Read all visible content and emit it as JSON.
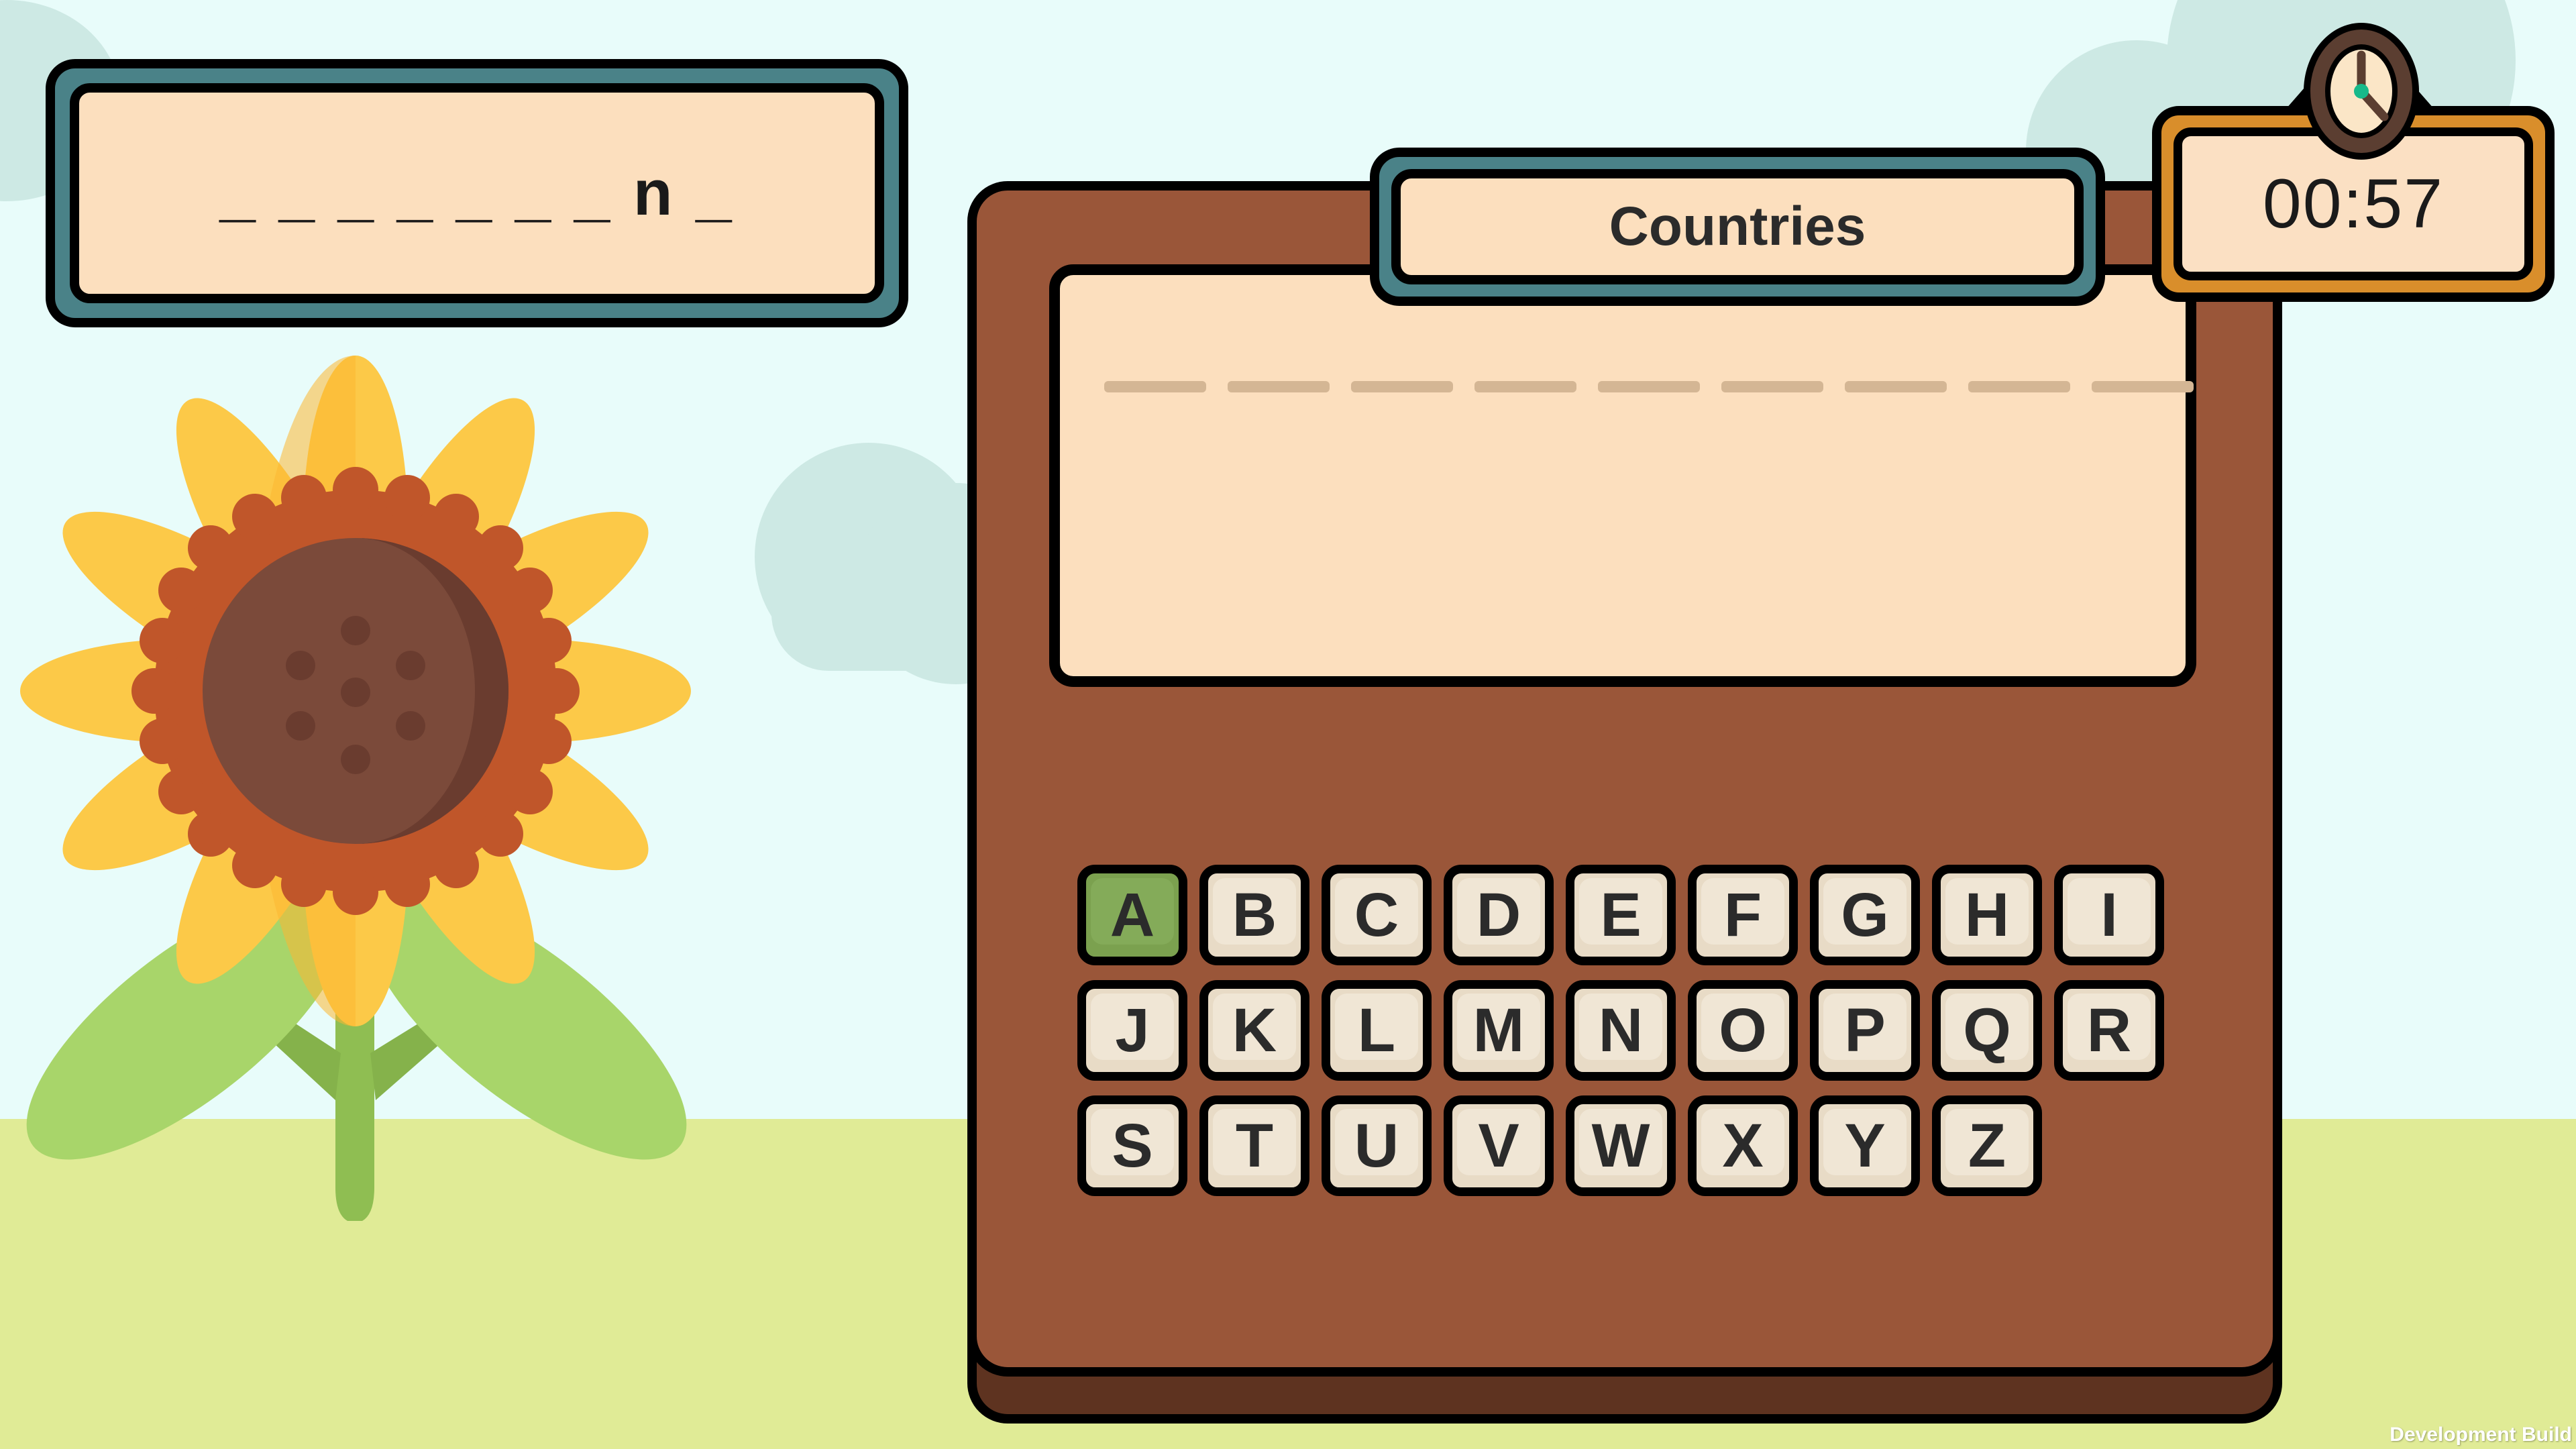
{
  "app": {
    "watermark": "Development Build"
  },
  "background": {
    "sky_color": "#E8FCFA",
    "ground_color": "#E0EB96",
    "cloud_color": "#CDE9E4"
  },
  "hint_display": {
    "label": "word-progress",
    "text": "_ _ _ _ _ _ _ n _",
    "frame_color": "#4A8288",
    "face_color": "#FCDFBE"
  },
  "category": {
    "label": "Countries",
    "frame_color": "#4A8288"
  },
  "timer": {
    "value": "00:57",
    "frame_color": "#D98E2B",
    "clock_center_color": "#17B98A"
  },
  "board": {
    "body_color": "#9A5639",
    "base_color": "#5E3320",
    "guess_panel_color": "#FCDFBE",
    "dash_color": "#D4B694",
    "dash_count": 9
  },
  "keyboard": {
    "used_key_color": "#7BA14F",
    "key_color": "#E8DBC6",
    "rows": [
      {
        "keys": [
          {
            "letter": "A",
            "used": true
          },
          {
            "letter": "B",
            "used": false
          },
          {
            "letter": "C",
            "used": false
          },
          {
            "letter": "D",
            "used": false
          },
          {
            "letter": "E",
            "used": false
          },
          {
            "letter": "F",
            "used": false
          },
          {
            "letter": "G",
            "used": false
          },
          {
            "letter": "H",
            "used": false
          },
          {
            "letter": "I",
            "used": false
          }
        ]
      },
      {
        "keys": [
          {
            "letter": "J",
            "used": false
          },
          {
            "letter": "K",
            "used": false
          },
          {
            "letter": "L",
            "used": false
          },
          {
            "letter": "M",
            "used": false
          },
          {
            "letter": "N",
            "used": false
          },
          {
            "letter": "O",
            "used": false
          },
          {
            "letter": "P",
            "used": false
          },
          {
            "letter": "Q",
            "used": false
          },
          {
            "letter": "R",
            "used": false
          }
        ]
      },
      {
        "keys": [
          {
            "letter": "S",
            "used": false
          },
          {
            "letter": "T",
            "used": false
          },
          {
            "letter": "U",
            "used": false
          },
          {
            "letter": "V",
            "used": false
          },
          {
            "letter": "W",
            "used": false
          },
          {
            "letter": "X",
            "used": false
          },
          {
            "letter": "Y",
            "used": false
          },
          {
            "letter": "Z",
            "used": false
          }
        ]
      }
    ]
  },
  "decoration": {
    "flower": "sunflower",
    "petal_color": "#FCC948",
    "petal_shade_color": "#FBB731",
    "disc_ring_color": "#C0562A",
    "disc_color": "#7B4A3A",
    "stem_color": "#8FBE52",
    "leaf_color": "#A8D56A"
  }
}
